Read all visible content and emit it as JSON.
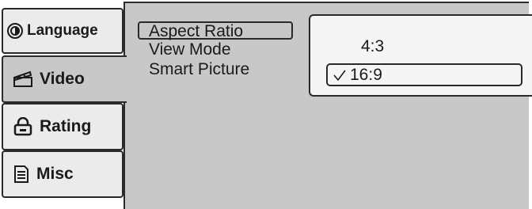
{
  "tabs": [
    {
      "label": "Language",
      "icon": "language-icon"
    },
    {
      "label": "Video",
      "icon": "clapperboard-icon"
    },
    {
      "label": "Rating",
      "icon": "lock-icon"
    },
    {
      "label": "Misc",
      "icon": "document-icon"
    }
  ],
  "menu": {
    "items": [
      "Aspect Ratio",
      "View Mode",
      "Smart Picture"
    ],
    "selected": "Aspect Ratio"
  },
  "submenu": {
    "options": [
      "4:3",
      "16:9"
    ],
    "checked": "16:9"
  },
  "colors": {
    "panel": "#c8c8c8",
    "border": "#2a2a2a"
  }
}
